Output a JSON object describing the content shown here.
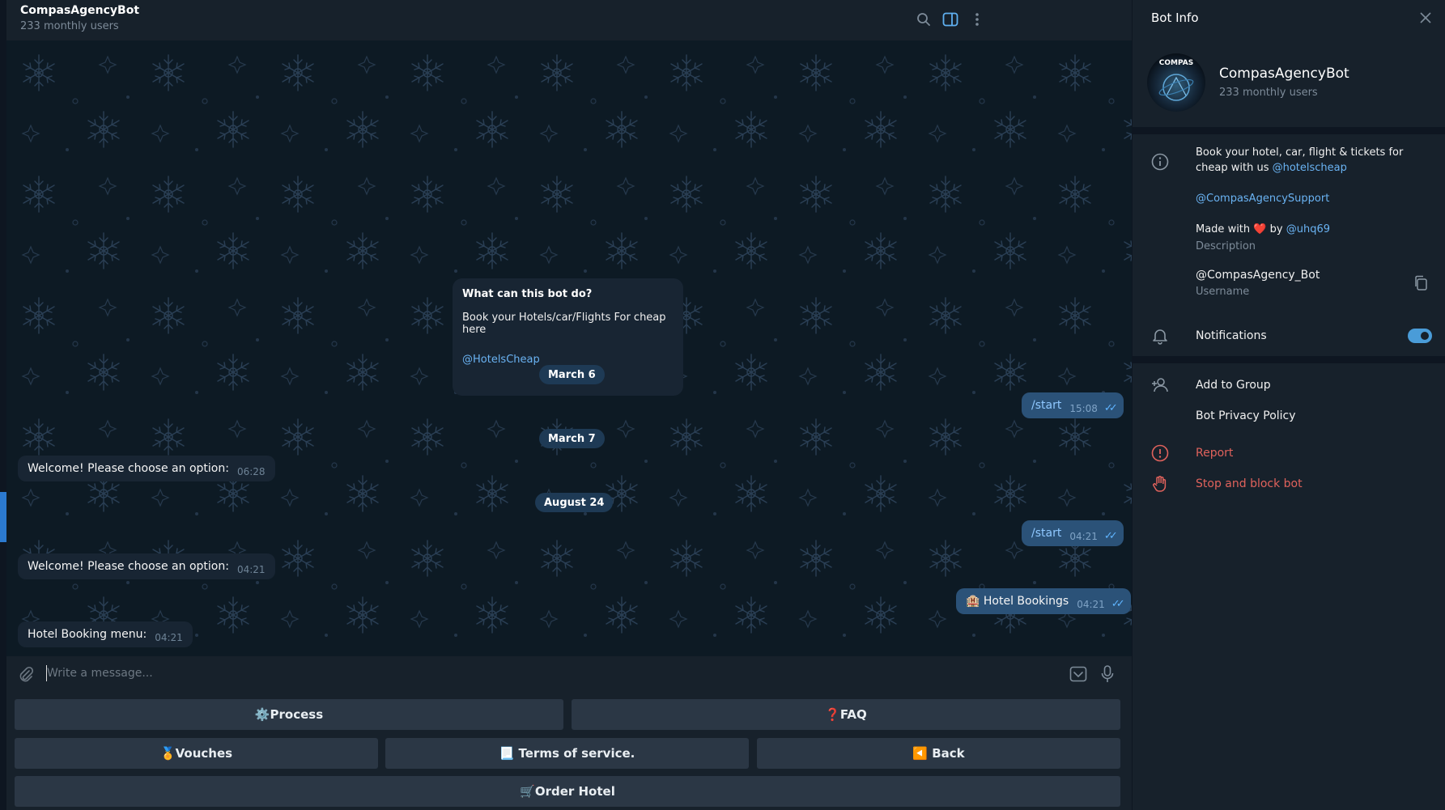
{
  "chat": {
    "title": "CompasAgencyBot",
    "subtitle": "233 monthly users",
    "intro": {
      "title": "What can this bot do?",
      "text": "Book your Hotels/car/Flights For cheap here",
      "link": "@HotelsCheap"
    },
    "dates": [
      "March 6",
      "March 7",
      "August 24"
    ],
    "messages": [
      {
        "dir": "out",
        "text": "/start",
        "time": "15:08"
      },
      {
        "dir": "in",
        "text": "Welcome! Please choose an option:",
        "time": "06:28"
      },
      {
        "dir": "out",
        "text": "/start",
        "time": "04:21"
      },
      {
        "dir": "in",
        "text": "Welcome! Please choose an option:",
        "time": "04:21"
      },
      {
        "dir": "out",
        "text": "🏨 Hotel Bookings",
        "time": "04:21"
      },
      {
        "dir": "in",
        "text": "Hotel Booking menu:",
        "time": "04:21"
      }
    ],
    "input_placeholder": "Write a message..."
  },
  "keyboard": {
    "process": "⚙️Process",
    "faq": "❓FAQ",
    "vouches": "🏅Vouches",
    "terms": "📃 Terms of service.",
    "back": "◀️ Back",
    "order": "🛒Order Hotel"
  },
  "info": {
    "header": "Bot Info",
    "name": "CompasAgencyBot",
    "subtitle": "233 monthly users",
    "avatar_text": "COMPAS",
    "desc_line1": "Book your hotel, car, flight & tickets for cheap with us ",
    "desc_link1": "@hotelscheap",
    "desc_link2": "@CompasAgencySupport",
    "made_with": "Made with",
    "heart": "❤️",
    "by": "by",
    "maker": "@uhq69",
    "desc_label": "Description",
    "username": "@CompasAgency_Bot",
    "username_label": "Username",
    "notifications": "Notifications",
    "notifications_on": true,
    "add_to_group": "Add to Group",
    "privacy": "Bot Privacy Policy",
    "report": "Report",
    "stop": "Stop and block bot"
  },
  "colors": {
    "accent": "#6ab3f3",
    "danger": "#e0625c",
    "outgoing_bubble": "#2b5278",
    "incoming_bubble": "#182533"
  }
}
